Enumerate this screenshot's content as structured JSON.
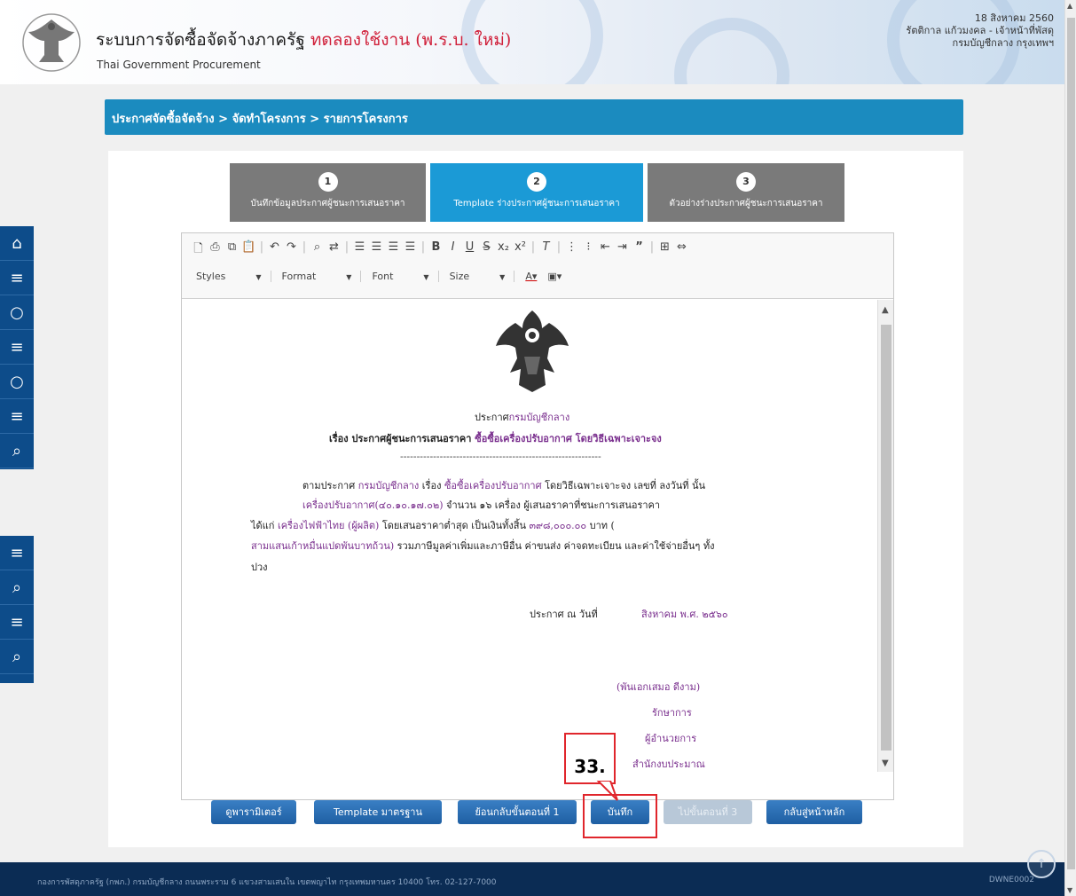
{
  "header": {
    "title_main": "ระบบการจัดซื้อจัดจ้างภาครัฐ",
    "title_trial": "ทดลองใช้งาน (พ.ร.บ. ใหม่)",
    "subtitle": "Thai Government Procurement",
    "date": "18 สิงหาคม 2560",
    "user": "รัตติกาล แก้วมงคล - เจ้าหน้าที่พัสดุ",
    "department": "กรมบัญชีกลาง กรุงเทพฯ"
  },
  "breadcrumb": "ประกาศจัดซื้อจัดจ้าง > จัดทำโครงการ > รายการโครงการ",
  "steps": [
    {
      "num": "1",
      "label": "บันทึกข้อมูลประกาศผู้ชนะการเสนอราคา"
    },
    {
      "num": "2",
      "label": "Template ร่างประกาศผู้ชนะการเสนอราคา"
    },
    {
      "num": "3",
      "label": "ตัวอย่างร่างประกาศผู้ชนะการเสนอราคา"
    }
  ],
  "toolbar": {
    "styles": "Styles",
    "format": "Format",
    "font": "Font",
    "size": "Size"
  },
  "document": {
    "heading_prefix": "ประกาศ",
    "heading_org": "กรมบัญชีกลาง",
    "subject_prefix": "เรื่อง ประกาศผู้ชนะการเสนอราคา",
    "subject_item": "ซื้อซื้อเครื่องปรับอากาศ โดยวิธีเฉพาะเจาะจง",
    "divider": "-------------------------------------------------------------",
    "p1_a": "ตามประกาศ",
    "p1_org": "กรมบัญชีกลาง",
    "p1_b": "เรื่อง",
    "p1_item": "ซื้อซื้อเครื่องปรับอากาศ",
    "p1_c": "โดยวิธีเฉพาะเจาะจง เลขที่ ลงวันที่ นั้น",
    "p2_item": "เครื่องปรับอากาศ(๔๐.๑๐.๑๗.๐๒)",
    "p2_rest": "จำนวน ๑๖ เครื่อง ผู้เสนอราคาที่ชนะการเสนอราคา",
    "p3_a": "ได้แก่",
    "p3_vendor": "เครื่องไฟฟ้าไทย (ผู้ผลิต)",
    "p3_b": "โดยเสนอราคาต่ำสุด เป็นเงินทั้งสิ้น",
    "p3_amount": "๓๙๘,๐๐๐.๐๐",
    "p3_c": "บาท (",
    "p4_words": "สามแสนเก้าหมื่นแปดพันบาทถ้วน)",
    "p4_rest": "รวมภาษีมูลค่าเพิ่มและภาษีอื่น ค่าขนส่ง ค่าจดทะเบียน และค่าใช้จ่ายอื่นๆ ทั้ง",
    "p5": "ปวง",
    "announce_label": "ประกาศ ณ วันที่",
    "announce_date": "สิงหาคม พ.ศ. ๒๕๖๐",
    "signer_name": "(พันเอกเสมอ ดีงาม)",
    "signer_role1": "รักษาการ",
    "signer_role2": "ผู้อำนวยการ",
    "signer_office": "สำนักงบประมาณ"
  },
  "buttons": {
    "params": "ดูพารามิเตอร์",
    "template": "Template มาตรฐาน",
    "back_step": "ย้อนกลับขั้นตอนที่ 1",
    "save": "บันทึก",
    "next_step": "ไปขั้นตอนที่ 3",
    "home": "กลับสู่หน้าหลัก"
  },
  "annotation": "33.",
  "footer": {
    "address": "กองการพัสดุภาครัฐ (กพภ.) กรมบัญชีกลาง ถนนพระราม 6 แขวงสามเสนใน เขตพญาไท กรุงเทพมหานคร 10400 โทร. 02-127-7000",
    "code": "DWNE0002"
  },
  "colors": {
    "accent": "#1b8bbf",
    "step_active": "#1b9ad6",
    "step_inactive": "#7a7a7a",
    "button": "#2a6fb5",
    "annotation": "#e0262c",
    "doc_highlight": "#7a2f8e",
    "rail": "#0d4c8a",
    "footer": "#0b2c54"
  }
}
